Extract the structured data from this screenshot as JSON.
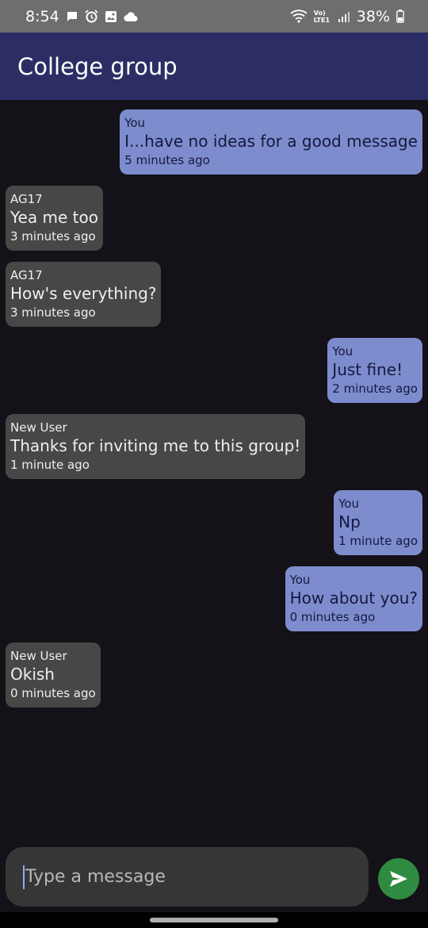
{
  "status_bar": {
    "time": "8:54",
    "battery": "38%",
    "network": "Vo) LTE1",
    "icons": [
      "chat-icon",
      "alarm-icon",
      "image-icon",
      "cloud-icon",
      "wifi-icon",
      "signal-icon",
      "battery-icon"
    ]
  },
  "app_bar": {
    "title": "College group"
  },
  "messages": [
    {
      "direction": "out",
      "sender": "You",
      "text": "I...have no ideas for a good message",
      "time": "5 minutes ago"
    },
    {
      "direction": "in",
      "sender": "AG17",
      "text": "Yea me too",
      "time": "3 minutes ago"
    },
    {
      "direction": "in",
      "sender": "AG17",
      "text": "How's everything?",
      "time": "3 minutes ago"
    },
    {
      "direction": "out",
      "sender": "You",
      "text": "Just fine!",
      "time": "2 minutes ago"
    },
    {
      "direction": "in",
      "sender": "New User",
      "text": "Thanks for inviting me to this group!",
      "time": "1 minute ago"
    },
    {
      "direction": "out",
      "sender": "You",
      "text": "Np",
      "time": "1 minute ago"
    },
    {
      "direction": "out",
      "sender": "You",
      "text": "How about you?",
      "time": "0 minutes ago"
    },
    {
      "direction": "in",
      "sender": "New User",
      "text": "Okish",
      "time": "0 minutes ago"
    }
  ],
  "composer": {
    "placeholder": "Type a message",
    "value": ""
  },
  "colors": {
    "app_bar": "#2b2d64",
    "background": "#141218",
    "outgoing_bubble": "#7d8ccd",
    "incoming_bubble": "#464848",
    "send_button": "#2e8b3f"
  }
}
